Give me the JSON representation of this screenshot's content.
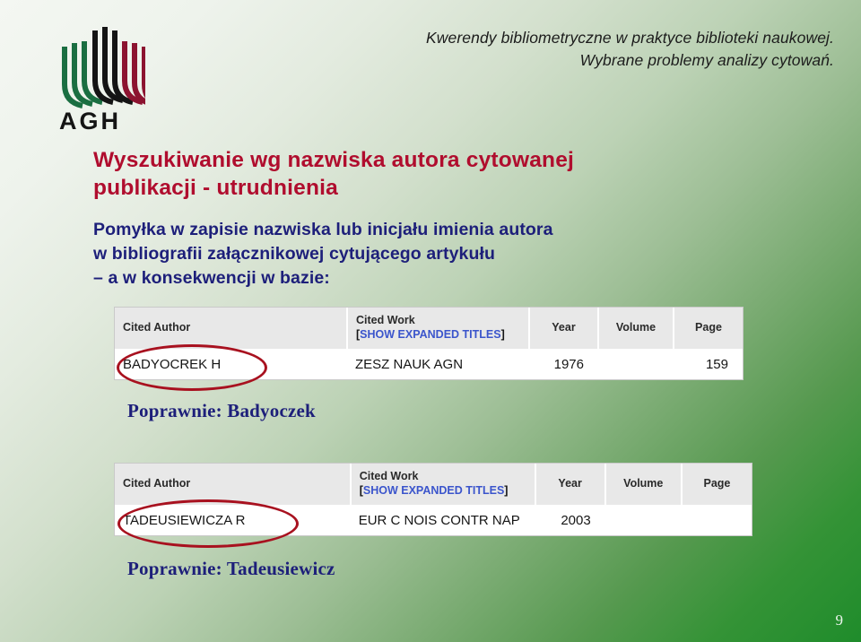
{
  "slide": {
    "number": "9",
    "logo": {
      "wordmark": "AGH",
      "bar_colors": [
        "#1a6e41",
        "#141414",
        "#8c1330"
      ]
    },
    "running_title": {
      "line1": "Kwerendy bibliometryczne w praktyce biblioteki naukowej.",
      "line2": "Wybrane problemy analizy cytowań."
    },
    "title": {
      "line1": "Wyszukiwanie wg nazwiska autora cytowanej",
      "line2": "publikacji - utrudnienia",
      "color": "#b00d2e"
    },
    "body": {
      "line1": "Pomyłka w zapisie nazwiska lub inicjału imienia autora",
      "line2": "w bibliografii załącznikowej cytującego artykułu",
      "line3": "– a w konsekwencji w bazie:",
      "color": "#1d1f7a"
    },
    "tables": [
      {
        "headers": {
          "cited_author": "Cited Author",
          "cited_work": "Cited Work",
          "expanded_open": "[",
          "expanded_link": "SHOW EXPANDED TITLES",
          "expanded_close": "]",
          "year": "Year",
          "volume": "Volume",
          "page": "Page"
        },
        "row": {
          "cited_author": "BADYOCREK H",
          "cited_work": "ZESZ NAUK AGN",
          "year": "1976",
          "volume": "",
          "page": "159"
        }
      },
      {
        "headers": {
          "cited_author": "Cited Author",
          "cited_work": "Cited Work",
          "expanded_open": "[",
          "expanded_link": "SHOW EXPANDED TITLES",
          "expanded_close": "]",
          "year": "Year",
          "volume": "Volume",
          "page": "Page"
        },
        "row": {
          "cited_author": "TADEUSIEWICZA R",
          "cited_work": "EUR C NOIS CONTR NAP",
          "year": "2003",
          "volume": "",
          "page": ""
        }
      }
    ],
    "captions": {
      "first": "Poprawnie: Badyoczek",
      "second": "Poprawnie: Tadeusiewicz"
    },
    "annotation_color": "#a8111f"
  }
}
